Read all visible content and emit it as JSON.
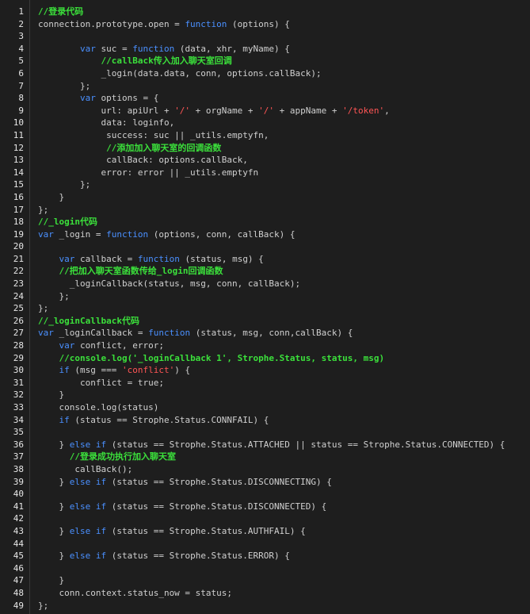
{
  "editor": {
    "colors": {
      "background": "#1e1e1e",
      "keyword": "#4a90ff",
      "comment": "#3be03b",
      "string": "#ff5555",
      "text": "#d0d0d0",
      "line_number": "#e6e6e6"
    },
    "lines": [
      {
        "number": "1",
        "tokens": [
          {
            "t": "comment",
            "v": "//登录代码"
          }
        ]
      },
      {
        "number": "2",
        "tokens": [
          {
            "t": "plain",
            "v": "connection.prototype.open = "
          },
          {
            "t": "keyword",
            "v": "function"
          },
          {
            "t": "plain",
            "v": " (options) {"
          }
        ]
      },
      {
        "number": "3",
        "tokens": []
      },
      {
        "number": "4",
        "tokens": [
          {
            "t": "plain",
            "v": "        "
          },
          {
            "t": "keyword",
            "v": "var"
          },
          {
            "t": "plain",
            "v": " suc = "
          },
          {
            "t": "keyword",
            "v": "function"
          },
          {
            "t": "plain",
            "v": " (data, xhr, myName) {"
          }
        ]
      },
      {
        "number": "5",
        "tokens": [
          {
            "t": "plain",
            "v": "            "
          },
          {
            "t": "comment",
            "v": "//callBack传入加入聊天室回调"
          }
        ]
      },
      {
        "number": "6",
        "tokens": [
          {
            "t": "plain",
            "v": "            _login(data.data, conn, options.callBack);"
          }
        ]
      },
      {
        "number": "7",
        "tokens": [
          {
            "t": "plain",
            "v": "        };"
          }
        ]
      },
      {
        "number": "8",
        "tokens": [
          {
            "t": "plain",
            "v": "        "
          },
          {
            "t": "keyword",
            "v": "var"
          },
          {
            "t": "plain",
            "v": " options = {"
          }
        ]
      },
      {
        "number": "9",
        "tokens": [
          {
            "t": "plain",
            "v": "            url: apiUrl + "
          },
          {
            "t": "string",
            "v": "'/'"
          },
          {
            "t": "plain",
            "v": " + orgName + "
          },
          {
            "t": "string",
            "v": "'/'"
          },
          {
            "t": "plain",
            "v": " + appName + "
          },
          {
            "t": "string",
            "v": "'/token'"
          },
          {
            "t": "plain",
            "v": ","
          }
        ]
      },
      {
        "number": "10",
        "tokens": [
          {
            "t": "plain",
            "v": "            data: loginfo,"
          }
        ]
      },
      {
        "number": "11",
        "tokens": [
          {
            "t": "plain",
            "v": "             success: suc || _utils.emptyfn,"
          }
        ]
      },
      {
        "number": "12",
        "tokens": [
          {
            "t": "plain",
            "v": "             "
          },
          {
            "t": "comment",
            "v": "//添加加入聊天室的回调函数"
          }
        ]
      },
      {
        "number": "13",
        "tokens": [
          {
            "t": "plain",
            "v": "             callBack: options.callBack,"
          }
        ]
      },
      {
        "number": "14",
        "tokens": [
          {
            "t": "plain",
            "v": "            error: error || _utils.emptyfn"
          }
        ]
      },
      {
        "number": "15",
        "tokens": [
          {
            "t": "plain",
            "v": "        };"
          }
        ]
      },
      {
        "number": "16",
        "tokens": [
          {
            "t": "plain",
            "v": "    }"
          }
        ]
      },
      {
        "number": "17",
        "tokens": [
          {
            "t": "plain",
            "v": "};"
          }
        ]
      },
      {
        "number": "18",
        "tokens": [
          {
            "t": "comment",
            "v": "//_login代码"
          }
        ]
      },
      {
        "number": "19",
        "tokens": [
          {
            "t": "keyword",
            "v": "var"
          },
          {
            "t": "plain",
            "v": " _login = "
          },
          {
            "t": "keyword",
            "v": "function"
          },
          {
            "t": "plain",
            "v": " (options, conn, callBack) {"
          }
        ]
      },
      {
        "number": "20",
        "tokens": []
      },
      {
        "number": "21",
        "tokens": [
          {
            "t": "plain",
            "v": "    "
          },
          {
            "t": "keyword",
            "v": "var"
          },
          {
            "t": "plain",
            "v": " callback = "
          },
          {
            "t": "keyword",
            "v": "function"
          },
          {
            "t": "plain",
            "v": " (status, msg) {"
          }
        ]
      },
      {
        "number": "22",
        "tokens": [
          {
            "t": "plain",
            "v": "    "
          },
          {
            "t": "comment",
            "v": "//把加入聊天室函数传给_login回调函数"
          }
        ]
      },
      {
        "number": "23",
        "tokens": [
          {
            "t": "plain",
            "v": "      _loginCallback(status, msg, conn, callBack);"
          }
        ]
      },
      {
        "number": "24",
        "tokens": [
          {
            "t": "plain",
            "v": "    };"
          }
        ]
      },
      {
        "number": "25",
        "tokens": [
          {
            "t": "plain",
            "v": "};"
          }
        ]
      },
      {
        "number": "26",
        "tokens": [
          {
            "t": "comment",
            "v": "//_loginCallback代码"
          }
        ]
      },
      {
        "number": "27",
        "tokens": [
          {
            "t": "keyword",
            "v": "var"
          },
          {
            "t": "plain",
            "v": " _loginCallback = "
          },
          {
            "t": "keyword",
            "v": "function"
          },
          {
            "t": "plain",
            "v": " (status, msg, conn,callBack) {"
          }
        ]
      },
      {
        "number": "28",
        "tokens": [
          {
            "t": "plain",
            "v": "    "
          },
          {
            "t": "keyword",
            "v": "var"
          },
          {
            "t": "plain",
            "v": " conflict, error;"
          }
        ]
      },
      {
        "number": "29",
        "tokens": [
          {
            "t": "plain",
            "v": "    "
          },
          {
            "t": "comment",
            "v": "//console.log('_loginCallback 1', Strophe.Status, status, msg)"
          }
        ]
      },
      {
        "number": "30",
        "tokens": [
          {
            "t": "plain",
            "v": "    "
          },
          {
            "t": "keyword",
            "v": "if"
          },
          {
            "t": "plain",
            "v": " (msg === "
          },
          {
            "t": "string",
            "v": "'conflict'"
          },
          {
            "t": "plain",
            "v": ") {"
          }
        ]
      },
      {
        "number": "31",
        "tokens": [
          {
            "t": "plain",
            "v": "        conflict = true;"
          }
        ]
      },
      {
        "number": "32",
        "tokens": [
          {
            "t": "plain",
            "v": "    }"
          }
        ]
      },
      {
        "number": "33",
        "tokens": [
          {
            "t": "plain",
            "v": "    console.log(status)"
          }
        ]
      },
      {
        "number": "34",
        "tokens": [
          {
            "t": "plain",
            "v": "    "
          },
          {
            "t": "keyword",
            "v": "if"
          },
          {
            "t": "plain",
            "v": " (status == Strophe.Status.CONNFAIL) {"
          }
        ]
      },
      {
        "number": "35",
        "tokens": []
      },
      {
        "number": "36",
        "tokens": [
          {
            "t": "plain",
            "v": "    } "
          },
          {
            "t": "keyword",
            "v": "else if"
          },
          {
            "t": "plain",
            "v": " (status == Strophe.Status.ATTACHED || status == Strophe.Status.CONNECTED) {"
          }
        ]
      },
      {
        "number": "37",
        "tokens": [
          {
            "t": "plain",
            "v": "      "
          },
          {
            "t": "comment",
            "v": "//登录成功执行加入聊天室"
          }
        ]
      },
      {
        "number": "38",
        "tokens": [
          {
            "t": "plain",
            "v": "       callBack();"
          }
        ]
      },
      {
        "number": "39",
        "tokens": [
          {
            "t": "plain",
            "v": "    } "
          },
          {
            "t": "keyword",
            "v": "else if"
          },
          {
            "t": "plain",
            "v": " (status == Strophe.Status.DISCONNECTING) {"
          }
        ]
      },
      {
        "number": "40",
        "tokens": []
      },
      {
        "number": "41",
        "tokens": [
          {
            "t": "plain",
            "v": "    } "
          },
          {
            "t": "keyword",
            "v": "else if"
          },
          {
            "t": "plain",
            "v": " (status == Strophe.Status.DISCONNECTED) {"
          }
        ]
      },
      {
        "number": "42",
        "tokens": []
      },
      {
        "number": "43",
        "tokens": [
          {
            "t": "plain",
            "v": "    } "
          },
          {
            "t": "keyword",
            "v": "else if"
          },
          {
            "t": "plain",
            "v": " (status == Strophe.Status.AUTHFAIL) {"
          }
        ]
      },
      {
        "number": "44",
        "tokens": []
      },
      {
        "number": "45",
        "tokens": [
          {
            "t": "plain",
            "v": "    } "
          },
          {
            "t": "keyword",
            "v": "else if"
          },
          {
            "t": "plain",
            "v": " (status == Strophe.Status.ERROR) {"
          }
        ]
      },
      {
        "number": "46",
        "tokens": []
      },
      {
        "number": "47",
        "tokens": [
          {
            "t": "plain",
            "v": "    }"
          }
        ]
      },
      {
        "number": "48",
        "tokens": [
          {
            "t": "plain",
            "v": "    conn.context.status_now = status;"
          }
        ]
      },
      {
        "number": "49",
        "tokens": [
          {
            "t": "plain",
            "v": "};"
          }
        ]
      }
    ]
  }
}
